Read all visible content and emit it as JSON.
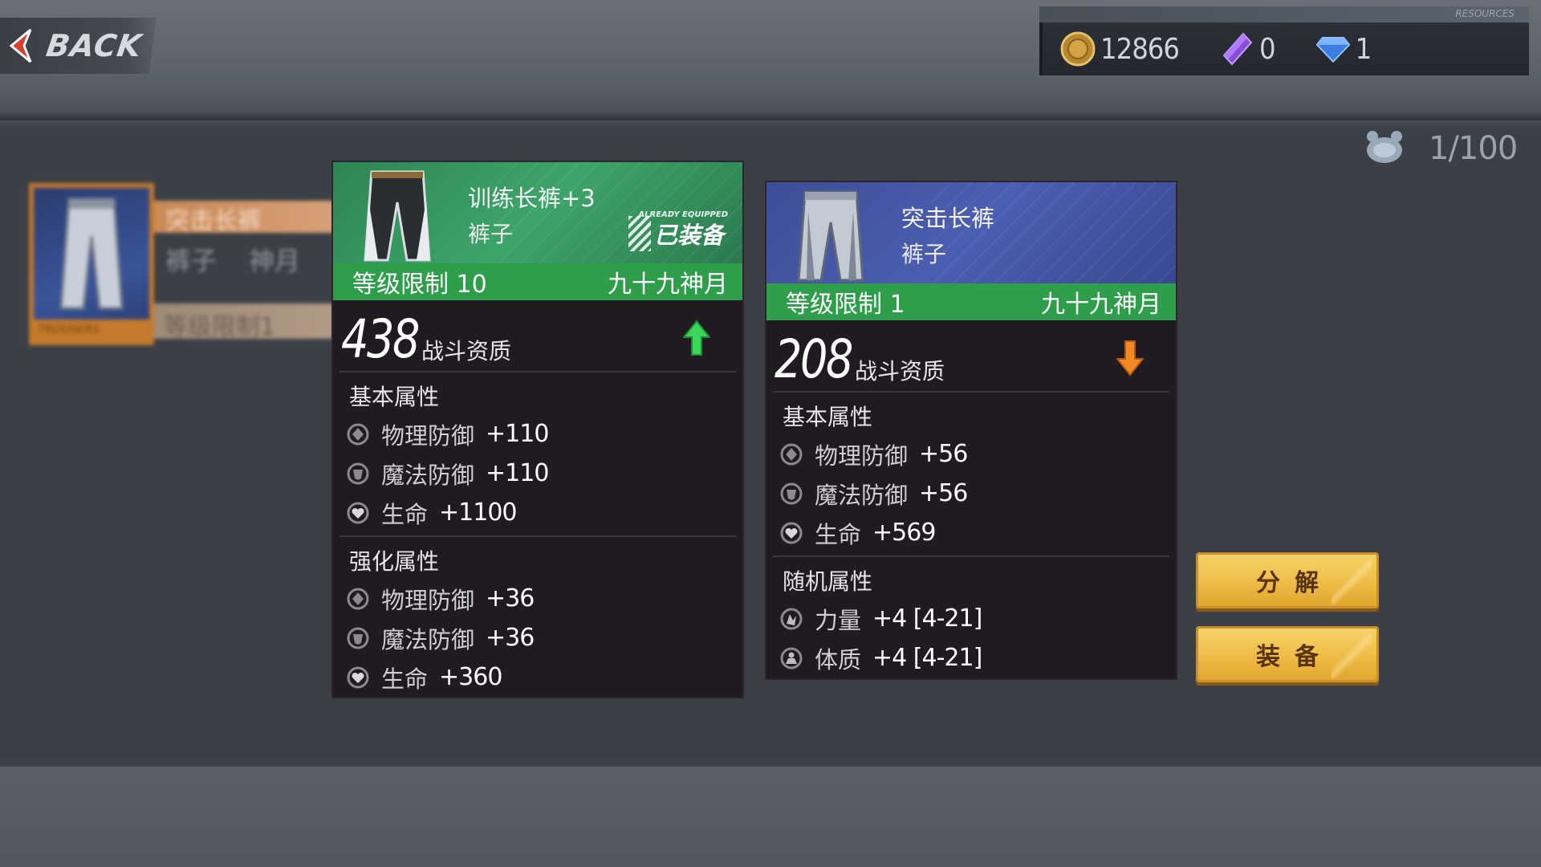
{
  "header": {
    "back_label": "BACK",
    "resources_tag": "RESOURCES"
  },
  "currencies": [
    {
      "icon": "gold-coin-icon",
      "value": "12866"
    },
    {
      "icon": "purple-crystal-icon",
      "value": "0"
    },
    {
      "icon": "diamond-icon",
      "value": "1"
    }
  ],
  "inventory": {
    "icon": "bag-icon",
    "count": "1/100"
  },
  "list_item": {
    "name": "突击长裤",
    "type": "裤子",
    "tier": "神月",
    "level": "等级限制1",
    "tag": "TROUSERS"
  },
  "equipped_card": {
    "name": "训练长裤+3",
    "type": "裤子",
    "badge_small": "ALREADY EQUIPPED",
    "badge": "已装备",
    "level": "等级限制 10",
    "tier": "九十九神月",
    "power": "438",
    "power_label": "战斗资质",
    "power_trend": "up",
    "sections": [
      {
        "title": "基本属性",
        "stats": [
          {
            "icon": "physical-defense-icon",
            "name": "物理防御",
            "value": "+110"
          },
          {
            "icon": "magic-defense-icon",
            "name": "魔法防御",
            "value": "+110"
          },
          {
            "icon": "heart-icon",
            "name": "生命",
            "value": "+1100"
          }
        ]
      },
      {
        "title": "强化属性",
        "stats": [
          {
            "icon": "physical-defense-icon",
            "name": "物理防御",
            "value": "+36"
          },
          {
            "icon": "magic-defense-icon",
            "name": "魔法防御",
            "value": "+36"
          },
          {
            "icon": "heart-icon",
            "name": "生命",
            "value": "+360"
          }
        ]
      }
    ]
  },
  "compare_card": {
    "name": "突击长裤",
    "type": "裤子",
    "level": "等级限制 1",
    "tier": "九十九神月",
    "power": "208",
    "power_label": "战斗资质",
    "power_trend": "down",
    "sections": [
      {
        "title": "基本属性",
        "stats": [
          {
            "icon": "physical-defense-icon",
            "name": "物理防御",
            "value": "+56"
          },
          {
            "icon": "magic-defense-icon",
            "name": "魔法防御",
            "value": "+56"
          },
          {
            "icon": "heart-icon",
            "name": "生命",
            "value": "+569"
          }
        ]
      },
      {
        "title": "随机属性",
        "stats": [
          {
            "icon": "strength-icon",
            "name": "力量",
            "value": "+4 [4-21]"
          },
          {
            "icon": "constitution-icon",
            "name": "体质",
            "value": "+4 [4-21]"
          }
        ]
      }
    ]
  },
  "actions": {
    "decompose": "分解",
    "equip": "装备"
  },
  "colors": {
    "level_bar": "#2f9e4b",
    "equipped_head": "#3ea46a",
    "compare_head": "#4b5eb0",
    "card_bg": "#201a21",
    "up_arrow": "#3ad65a",
    "down_arrow": "#f08a24",
    "button": "#eebc46"
  }
}
